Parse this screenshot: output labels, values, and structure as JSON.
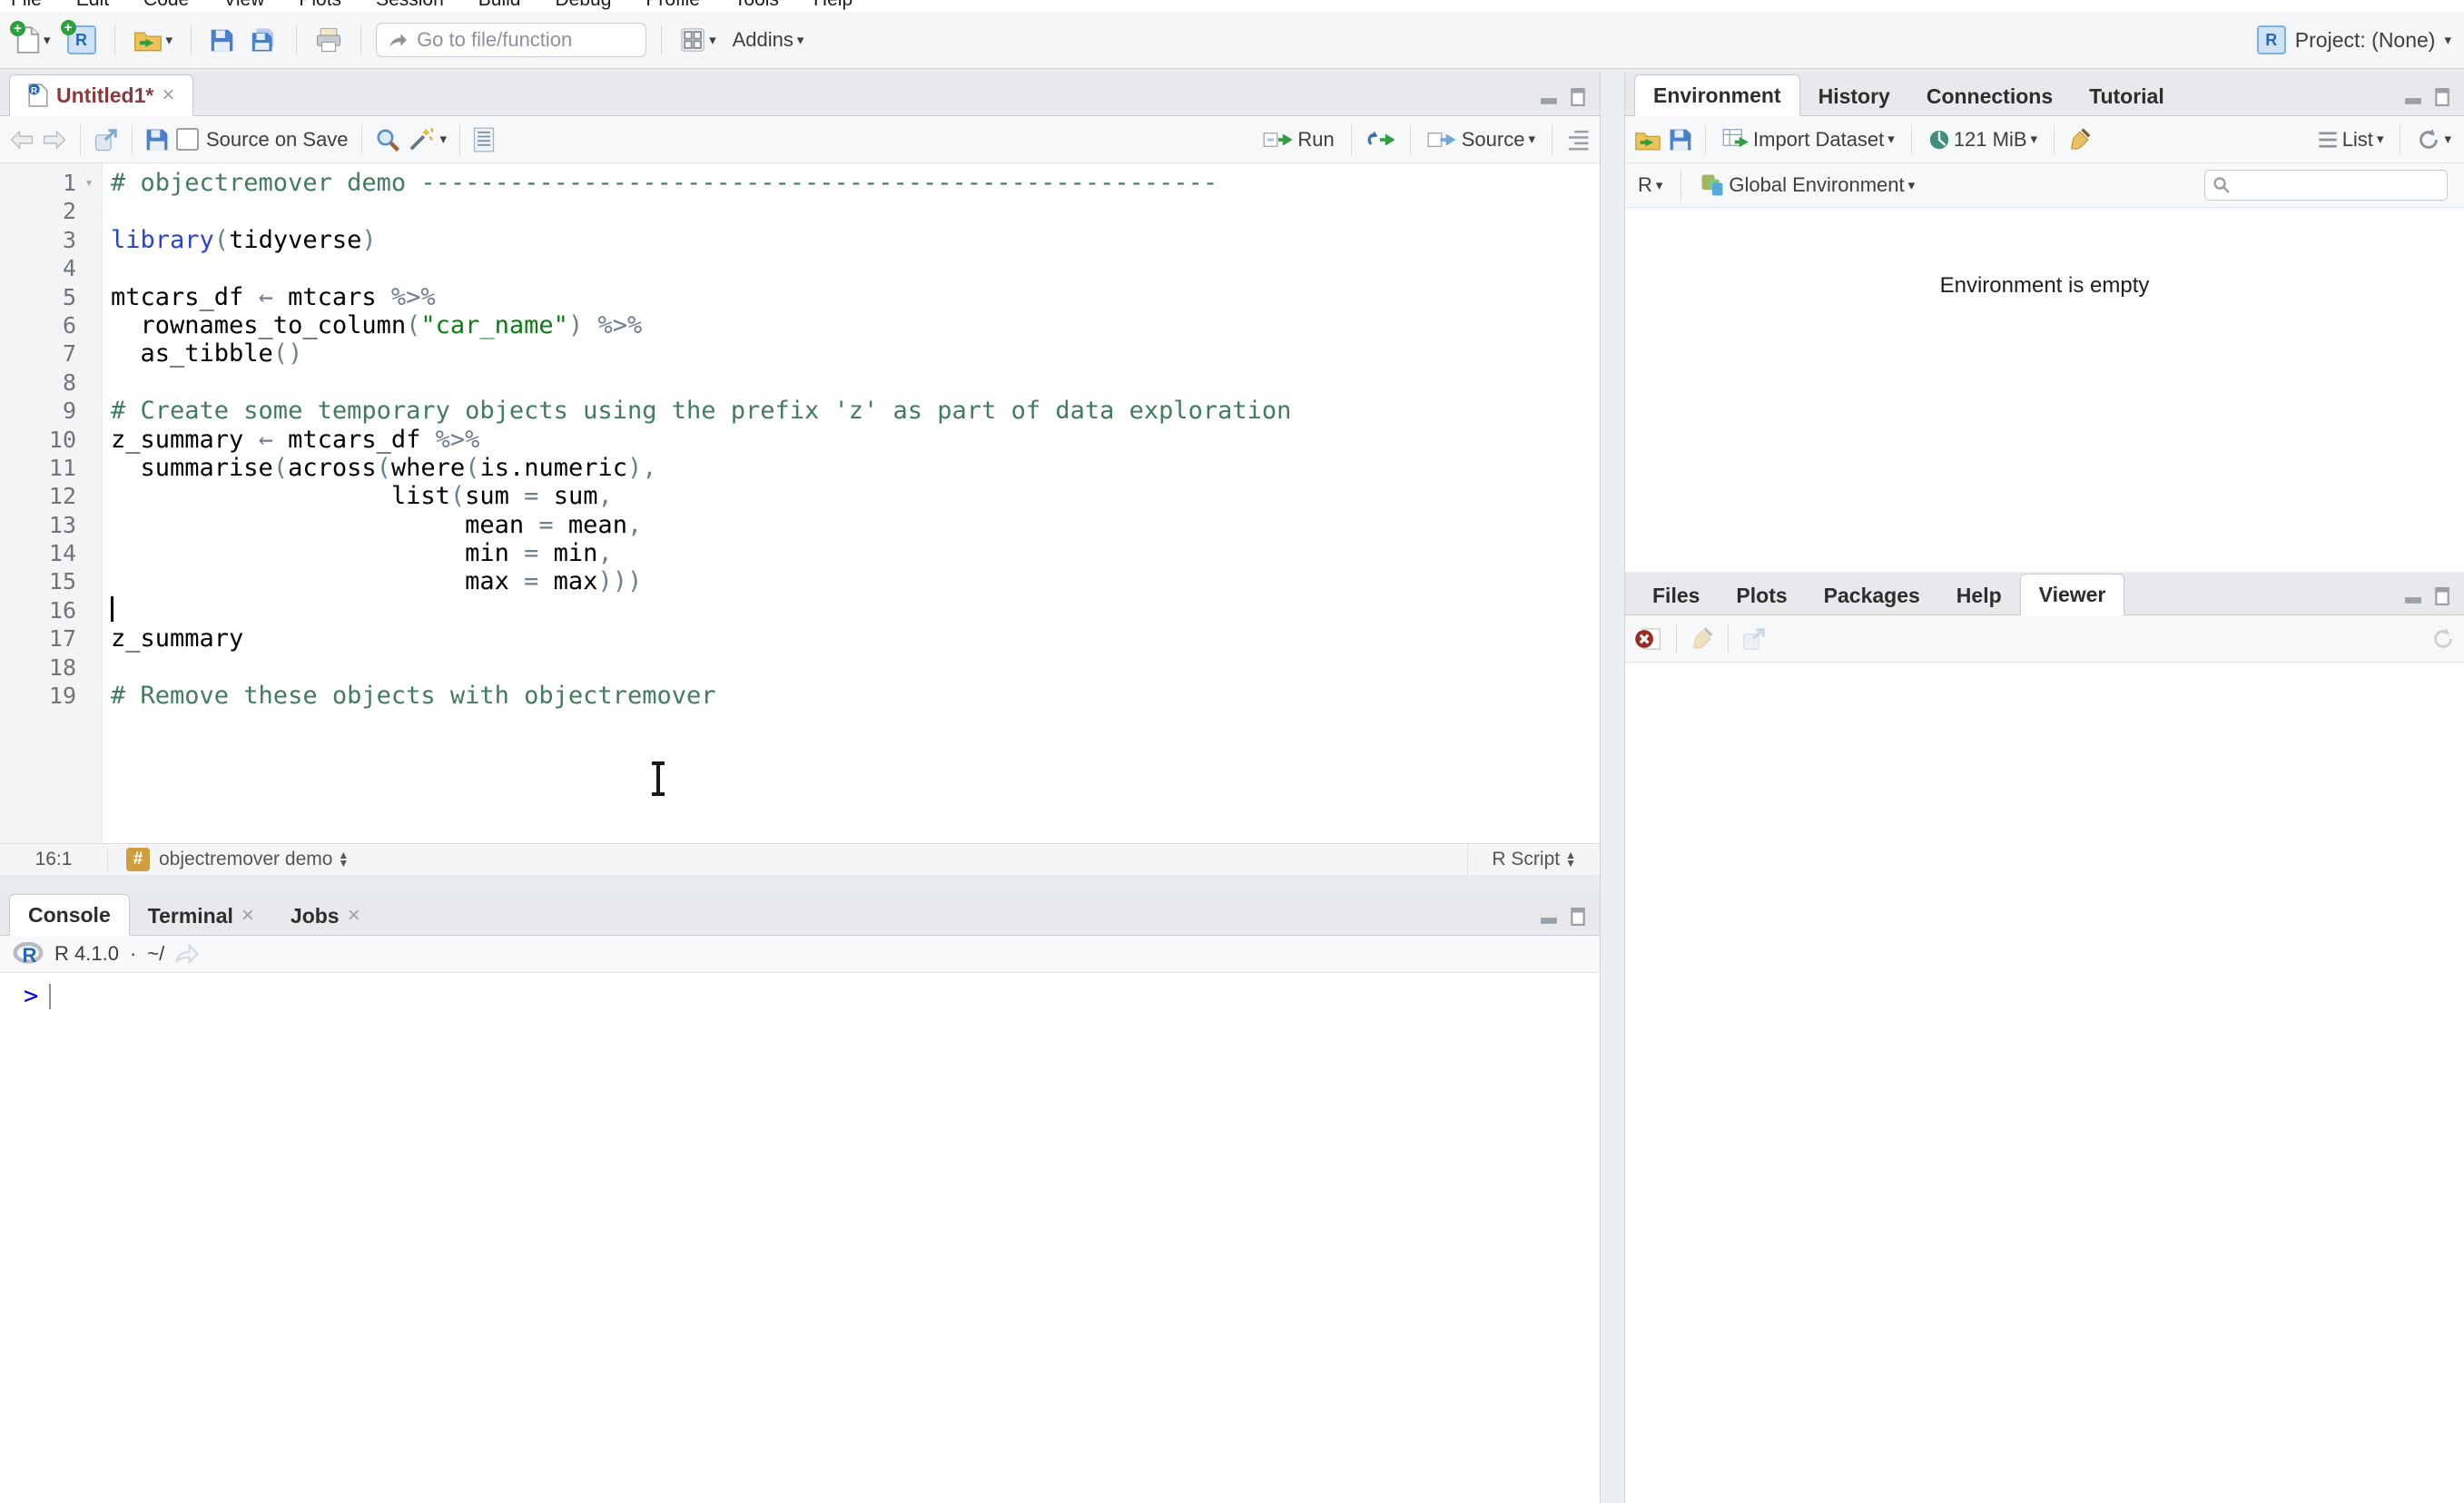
{
  "menu": {
    "items": [
      "File",
      "Edit",
      "Code",
      "View",
      "Plots",
      "Session",
      "Build",
      "Debug",
      "Profile",
      "Tools",
      "Help"
    ]
  },
  "toolbar": {
    "goto_placeholder": "Go to file/function",
    "addins_label": "Addins",
    "project_label": "Project: (None)"
  },
  "source_pane": {
    "tab_title": "Untitled1*",
    "source_on_save": "Source on Save",
    "run_label": "Run",
    "source_label": "Source",
    "status_position": "16:1",
    "status_section": "objectremover demo",
    "status_filetype": "R Script"
  },
  "editor": {
    "lines": [
      {
        "n": 1,
        "fold": true,
        "segs": [
          [
            "cm",
            "# objectremover demo ------------------------------------------------------"
          ]
        ]
      },
      {
        "n": 2,
        "segs": []
      },
      {
        "n": 3,
        "segs": [
          [
            "kw",
            "library"
          ],
          [
            "op",
            "("
          ],
          [
            "tx",
            "tidyverse"
          ],
          [
            "op",
            ")"
          ]
        ]
      },
      {
        "n": 4,
        "segs": []
      },
      {
        "n": 5,
        "segs": [
          [
            "tx",
            "mtcars_df "
          ],
          [
            "op",
            "← "
          ],
          [
            "tx",
            "mtcars "
          ],
          [
            "op",
            "%>%"
          ]
        ]
      },
      {
        "n": 6,
        "segs": [
          [
            "tx",
            "  rownames_to_column"
          ],
          [
            "op",
            "("
          ],
          [
            "str",
            "\"car_name\""
          ],
          [
            "op",
            ")"
          ],
          [
            "tx",
            " "
          ],
          [
            "op",
            "%>%"
          ]
        ]
      },
      {
        "n": 7,
        "segs": [
          [
            "tx",
            "  as_tibble"
          ],
          [
            "op",
            "()"
          ]
        ]
      },
      {
        "n": 8,
        "segs": []
      },
      {
        "n": 9,
        "segs": [
          [
            "cm",
            "# Create some temporary objects using the prefix 'z' as part of data exploration"
          ]
        ]
      },
      {
        "n": 10,
        "segs": [
          [
            "tx",
            "z_summary "
          ],
          [
            "op",
            "← "
          ],
          [
            "tx",
            "mtcars_df "
          ],
          [
            "op",
            "%>%"
          ]
        ]
      },
      {
        "n": 11,
        "segs": [
          [
            "tx",
            "  summarise"
          ],
          [
            "op",
            "("
          ],
          [
            "tx",
            "across"
          ],
          [
            "op",
            "("
          ],
          [
            "tx",
            "where"
          ],
          [
            "op",
            "("
          ],
          [
            "tx",
            "is.numeric"
          ],
          [
            "op",
            "),"
          ]
        ]
      },
      {
        "n": 12,
        "segs": [
          [
            "tx",
            "                   list"
          ],
          [
            "op",
            "("
          ],
          [
            "tx",
            "sum "
          ],
          [
            "op",
            "= "
          ],
          [
            "tx",
            "sum"
          ],
          [
            "op",
            ","
          ]
        ]
      },
      {
        "n": 13,
        "segs": [
          [
            "tx",
            "                        mean "
          ],
          [
            "op",
            "= "
          ],
          [
            "tx",
            "mean"
          ],
          [
            "op",
            ","
          ]
        ]
      },
      {
        "n": 14,
        "segs": [
          [
            "tx",
            "                        min "
          ],
          [
            "op",
            "= "
          ],
          [
            "tx",
            "min"
          ],
          [
            "op",
            ","
          ]
        ]
      },
      {
        "n": 15,
        "segs": [
          [
            "tx",
            "                        max "
          ],
          [
            "op",
            "= "
          ],
          [
            "tx",
            "max"
          ],
          [
            "op",
            ")))"
          ]
        ]
      },
      {
        "n": 16,
        "segs": []
      },
      {
        "n": 17,
        "segs": [
          [
            "tx",
            "z_summary"
          ]
        ]
      },
      {
        "n": 18,
        "segs": []
      },
      {
        "n": 19,
        "segs": [
          [
            "cm",
            "# Remove these objects with objectremover"
          ]
        ]
      }
    ]
  },
  "console": {
    "tabs": [
      {
        "label": "Console",
        "closable": false
      },
      {
        "label": "Terminal",
        "closable": true
      },
      {
        "label": "Jobs",
        "closable": true
      }
    ],
    "active_tab": "Console",
    "r_version": "R 4.1.0",
    "dot": "·",
    "working_dir": "~/",
    "prompt": ">"
  },
  "environment": {
    "tabs": [
      {
        "label": "Environment",
        "closable": false
      },
      {
        "label": "History",
        "closable": false
      },
      {
        "label": "Connections",
        "closable": false
      },
      {
        "label": "Tutorial",
        "closable": false
      }
    ],
    "active_tab": "Environment",
    "import_label": "Import Dataset",
    "memory_label": "121 MiB",
    "list_label": "List",
    "scope_r": "R",
    "scope_label": "Global Environment",
    "empty_text": "Environment is empty"
  },
  "files_pane": {
    "tabs": [
      {
        "label": "Files",
        "closable": false
      },
      {
        "label": "Plots",
        "closable": false
      },
      {
        "label": "Packages",
        "closable": false
      },
      {
        "label": "Help",
        "closable": false
      },
      {
        "label": "Viewer",
        "closable": false
      }
    ],
    "active_tab": "Viewer"
  },
  "colors": {
    "comment": "#417c5e",
    "keyword": "#2743cf",
    "string": "#0d7d12",
    "operator": "#6c7f93",
    "prompt_blue": "#0000e8",
    "section_badge": "#cf9f3f",
    "tab_modified": "#8b3b3b"
  }
}
